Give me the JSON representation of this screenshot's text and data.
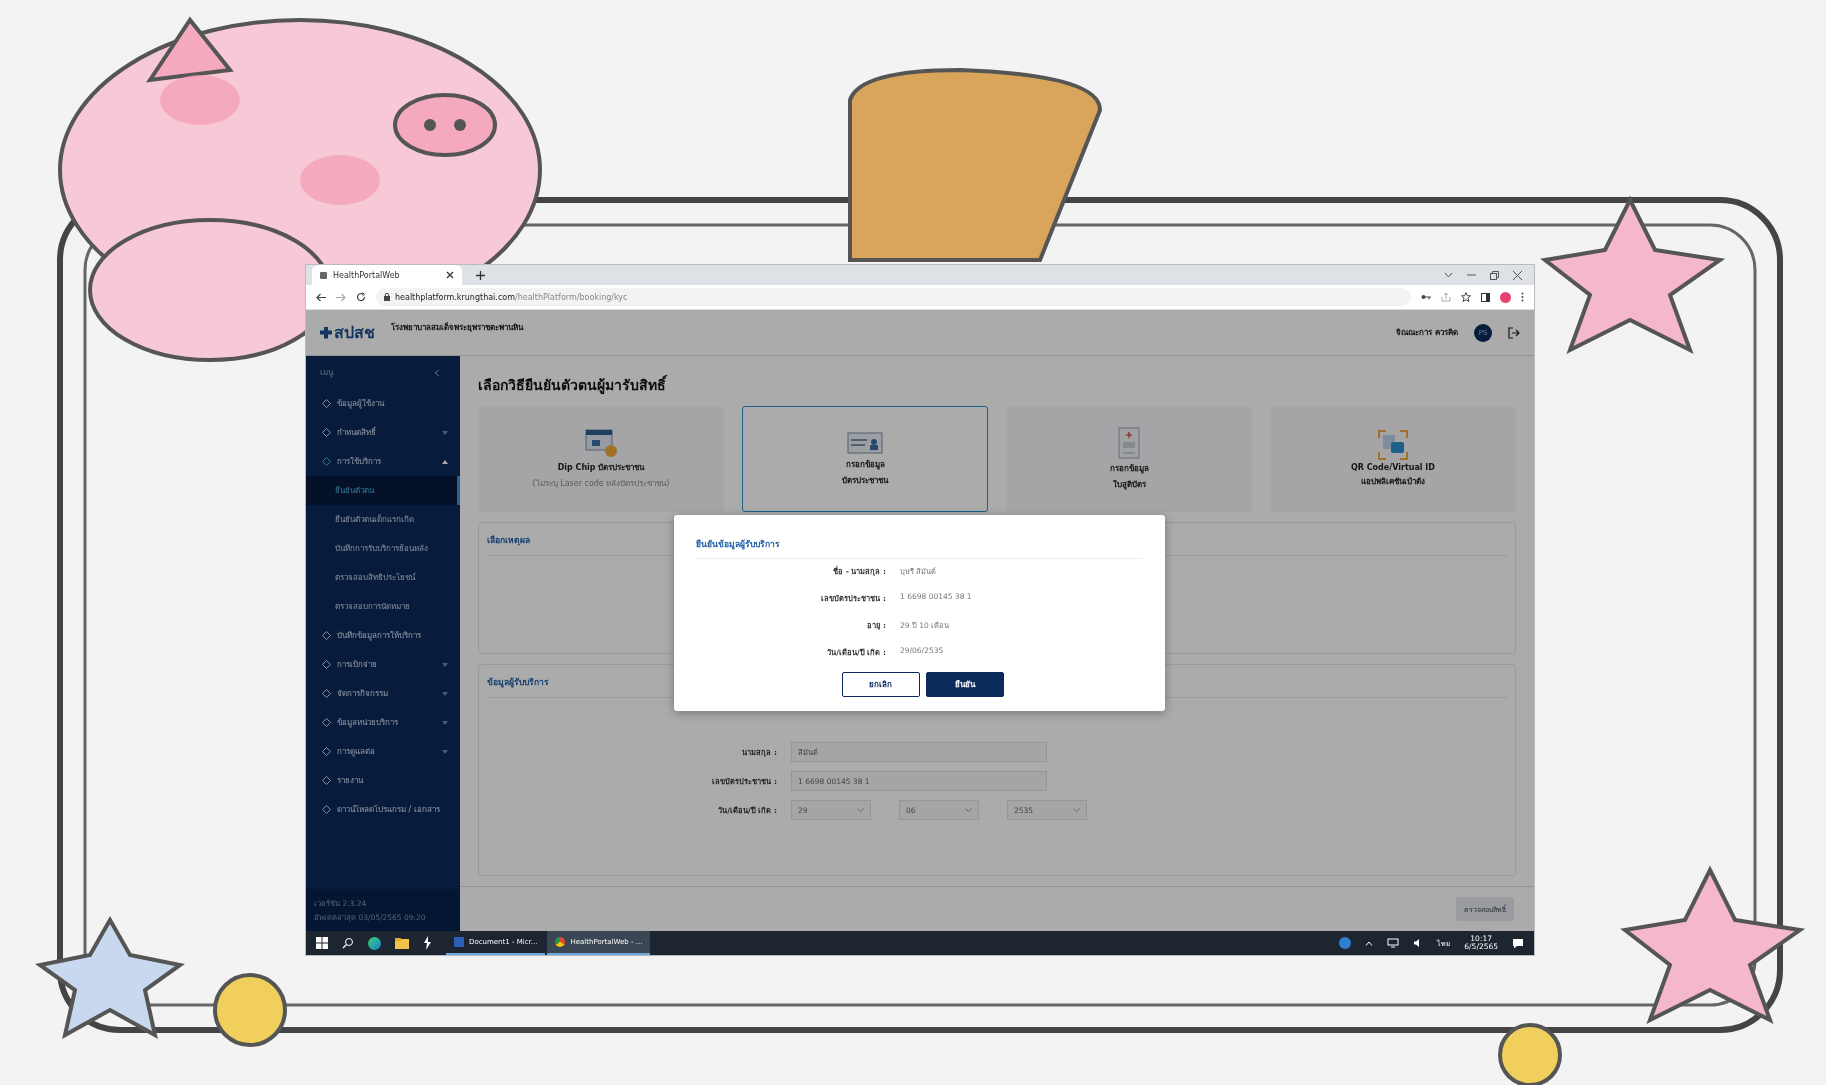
{
  "browser": {
    "tab_title": "HealthPortalWeb",
    "url_host": "healthplatform.krungthai.com",
    "url_path": "/healthPlatform/booking/kyc"
  },
  "header": {
    "logo_text": "สปสช",
    "org_name": "โรงพยาบาลสมเด็จพระยุพราชตะพานหิน",
    "user_name": "จิณณะการ ควรคิด",
    "avatar_initials": "PS"
  },
  "sidebar": {
    "menu_label": "เมนู",
    "items": [
      {
        "label": "ข้อมูลผู้ใช้งาน",
        "kind": "link",
        "selected": false
      },
      {
        "label": "กำหนดสิทธิ์",
        "kind": "group",
        "expanded": false,
        "selected": false
      },
      {
        "label": "การใช้บริการ",
        "kind": "group",
        "expanded": true,
        "selected": false,
        "children": [
          {
            "label": "ยืนยันตัวตน",
            "selected": true
          },
          {
            "label": "ยืนยันตัวตนเด็กแรกเกิด",
            "selected": false
          },
          {
            "label": "บันทึกการรับบริการย้อนหลัง",
            "selected": false
          },
          {
            "label": "ตรวจสอบสิทธิประโยชน์",
            "selected": false
          },
          {
            "label": "ตรวจสอบการนัดหมาย",
            "selected": false
          }
        ]
      },
      {
        "label": "บันทึกข้อมูลการให้บริการ",
        "kind": "link",
        "selected": false
      },
      {
        "label": "การเบิกจ่าย",
        "kind": "group",
        "expanded": false,
        "selected": false
      },
      {
        "label": "จัดการกิจกรรม",
        "kind": "group",
        "expanded": false,
        "selected": false
      },
      {
        "label": "ข้อมูลหน่วยบริการ",
        "kind": "group",
        "expanded": false,
        "selected": false
      },
      {
        "label": "การดูแลต่อ",
        "kind": "group",
        "expanded": false,
        "selected": false
      },
      {
        "label": "รายงาน",
        "kind": "link",
        "selected": false
      },
      {
        "label": "ดาวน์โหลดโปรแกรม / เอกสาร",
        "kind": "link",
        "selected": false
      }
    ],
    "version": "เวอร์ชัน 2.3.24",
    "updated": "อัพเดตล่าสุด 03/05/2565 09:20"
  },
  "page_title": "เลือกวิธียืนยันตัวตนผู้มารับสิทธิ์",
  "methods": [
    {
      "kind": "dipchip",
      "selected": false,
      "lines": [
        "Dip Chip บัตรประชาชน"
      ],
      "note": "(ไม่ระบุ Laser code หลังบัตรประชาชน)"
    },
    {
      "kind": "idcard",
      "selected": true,
      "lines": [
        "กรอกข้อมูล",
        "บัตรประชาชน"
      ]
    },
    {
      "kind": "birthcert",
      "selected": false,
      "lines": [
        "กรอกข้อมูล",
        "ใบสูติบัตร"
      ]
    },
    {
      "kind": "qr",
      "selected": false,
      "lines": [
        "QR Code/Virtual ID",
        "แอปพลิเคชันเป๋าตัง"
      ]
    }
  ],
  "reason_section": {
    "title": "เลือกเหตุผล"
  },
  "patient_section": {
    "title": "ข้อมูลผู้รับบริการ",
    "fields": [
      {
        "kind": "text",
        "label": "นามสกุล :",
        "value": "สิมันต์"
      },
      {
        "kind": "text",
        "label": "เลขบัตรประชาชน :",
        "value": "1 6698 00145 38 1"
      },
      {
        "kind": "date",
        "label": "วัน/เดือน/ปี เกิด :",
        "parts": [
          "29",
          "06",
          "2535"
        ]
      }
    ]
  },
  "footer": {
    "button": "ตรวจสอบสิทธิ์",
    "disabled": true
  },
  "dialog": {
    "title": "ยืนยันข้อมูลผู้รับบริการ",
    "rows": [
      {
        "label": "ชื่อ - นามสกุล :",
        "value": "บุษรี สิมันต์"
      },
      {
        "label": "เลขบัตรประชาชน :",
        "value": "1 6698 00145 38 1"
      },
      {
        "label": "อายุ :",
        "value": "29 ปี 10 เดือน"
      },
      {
        "label": "วัน/เดือน/ปี เกิด :",
        "value": "29/06/2535"
      }
    ],
    "cancel": "ยกเลิก",
    "confirm": "ยืนยัน"
  },
  "taskbar": {
    "apps": [
      {
        "kind": "word",
        "label": "Document1 - Micr...",
        "selected": false
      },
      {
        "kind": "chrome",
        "label": "HealthPortalWeb - ...",
        "selected": true
      }
    ],
    "language": "ไทย",
    "time": "10:17",
    "date": "6/5/2565"
  }
}
